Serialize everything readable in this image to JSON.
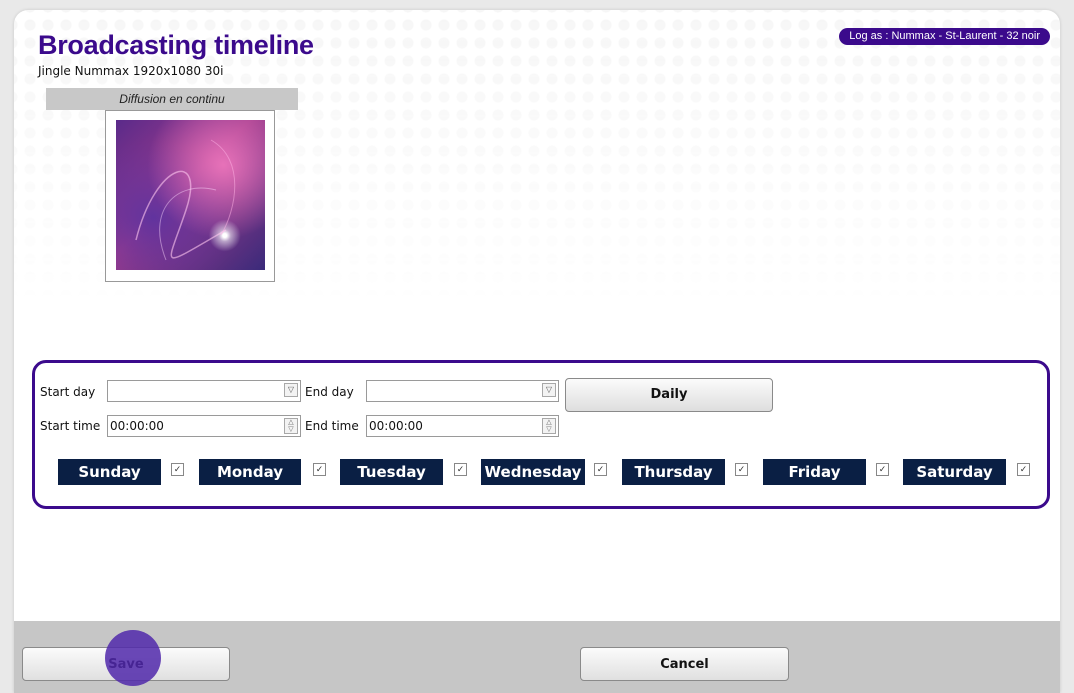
{
  "header": {
    "title": "Broadcasting timeline",
    "subtitle": "Jingle Nummax 1920x1080 30i",
    "login_badge": "Log as : Nummax - St-Laurent - 32 noir"
  },
  "preview": {
    "label": "Diffusion en continu"
  },
  "schedule": {
    "start_day_label": "Start day",
    "start_day_value": "",
    "end_day_label": "End day",
    "end_day_value": "",
    "daily_button": "Daily",
    "start_time_label": "Start time",
    "start_time_value": "00:00:00",
    "end_time_label": "End time",
    "end_time_value": "00:00:00",
    "days": [
      {
        "label": "Sunday",
        "checked": true
      },
      {
        "label": "Monday",
        "checked": true
      },
      {
        "label": "Tuesday",
        "checked": true
      },
      {
        "label": "Wednesday",
        "checked": true
      },
      {
        "label": "Thursday",
        "checked": true
      },
      {
        "label": "Friday",
        "checked": true
      },
      {
        "label": "Saturday",
        "checked": true
      }
    ]
  },
  "footer": {
    "save_button": "Save",
    "cancel_button": "Cancel"
  },
  "colors": {
    "accent": "#3b0a8c",
    "day_badge": "#0a1f44",
    "footer_bg": "#c6c6c6"
  },
  "icons": {
    "dropdown": "chevron-down-icon",
    "spinner": "spinner-arrows-icon",
    "checkbox": "checkbox-checked-icon"
  }
}
